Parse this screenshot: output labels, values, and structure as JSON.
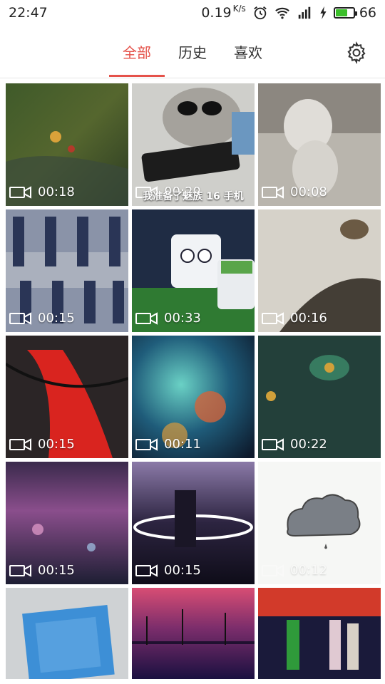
{
  "status": {
    "time": "22:47",
    "net_speed": "0.19",
    "net_unit": "K/s",
    "battery": "66",
    "battery_fraction": 0.66
  },
  "tabs": [
    {
      "label": "全部",
      "active": true
    },
    {
      "label": "历史",
      "active": false
    },
    {
      "label": "喜欢",
      "active": false
    }
  ],
  "accent_color": "#e5524a",
  "videos": [
    {
      "duration": "00:18",
      "caption": ""
    },
    {
      "duration": "00:20",
      "caption": "我准备了魅族 16 手机"
    },
    {
      "duration": "00:08",
      "caption": ""
    },
    {
      "duration": "00:15",
      "caption": ""
    },
    {
      "duration": "00:33",
      "caption": ""
    },
    {
      "duration": "00:16",
      "caption": ""
    },
    {
      "duration": "00:15",
      "caption": ""
    },
    {
      "duration": "00:11",
      "caption": ""
    },
    {
      "duration": "00:22",
      "caption": ""
    },
    {
      "duration": "00:15",
      "caption": ""
    },
    {
      "duration": "00:15",
      "caption": ""
    },
    {
      "duration": "00:12",
      "caption": ""
    },
    {
      "duration": "",
      "caption": ""
    },
    {
      "duration": "",
      "caption": ""
    },
    {
      "duration": "",
      "caption": ""
    }
  ]
}
